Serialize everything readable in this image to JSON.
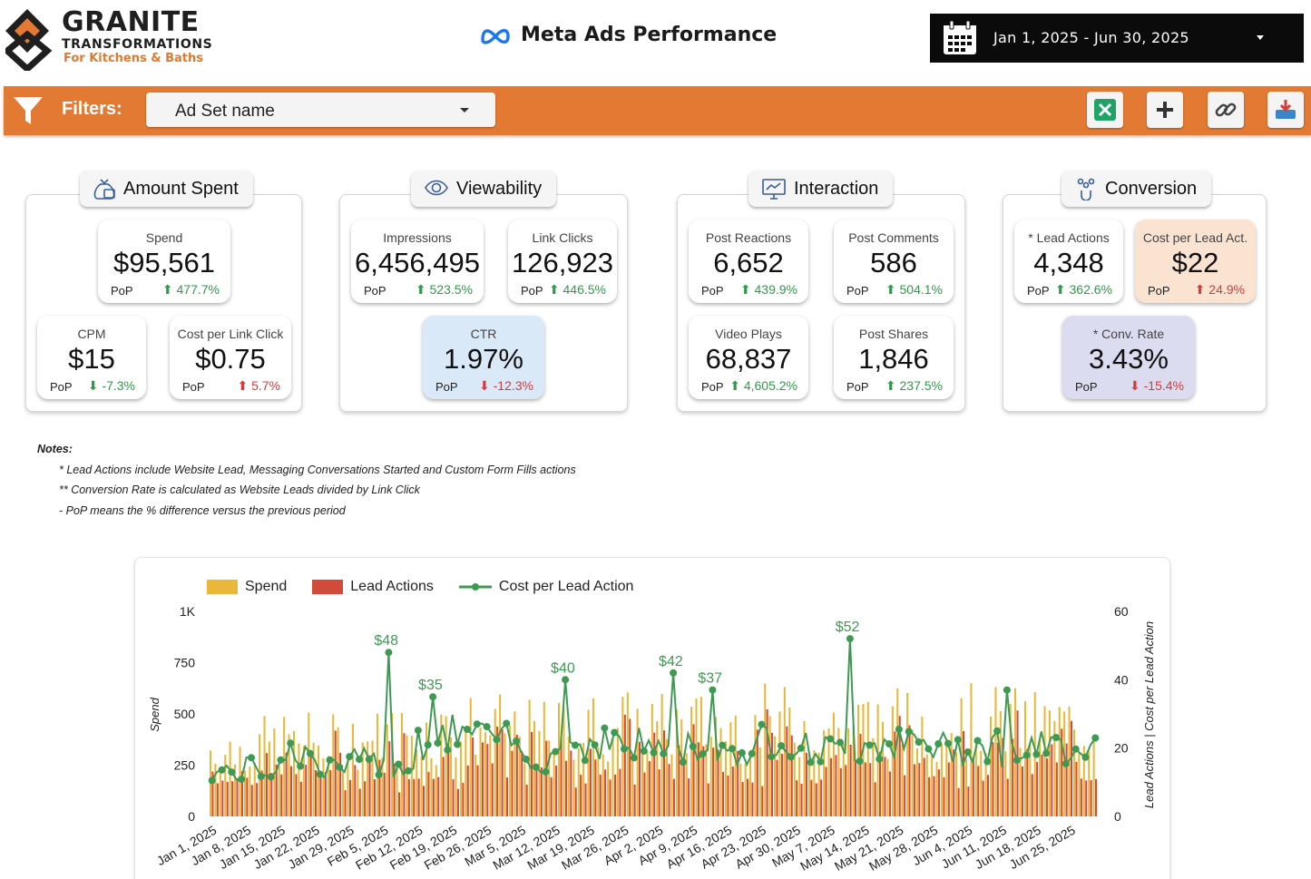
{
  "brand": {
    "name": "GRANITE",
    "line2": "TRANSFORMATIONS",
    "tagline": "For Kitchens & Baths",
    "accent": "#e37a33"
  },
  "header": {
    "title": "Meta Ads Performance",
    "date_range": "Jan 1, 2025 - Jun 30, 2025"
  },
  "filters": {
    "label": "Filters:",
    "selector": "Ad Set name"
  },
  "sections": {
    "amount_spent": "Amount Spent",
    "viewability": "Viewability",
    "interaction": "Interaction",
    "conversion": "Conversion"
  },
  "pop_label": "PoP",
  "metrics": {
    "spend": {
      "label": "Spend",
      "value": "$95,561",
      "change": "477.7%"
    },
    "cpm": {
      "label": "CPM",
      "value": "$15",
      "change": "-7.3%"
    },
    "cplc": {
      "label": "Cost per Link Click",
      "value": "$0.75",
      "change": "5.7%"
    },
    "impressions": {
      "label": "Impressions",
      "value": "6,456,495",
      "change": "523.5%"
    },
    "link_clicks": {
      "label": "Link Clicks",
      "value": "126,923",
      "change": "446.5%"
    },
    "ctr": {
      "label": "CTR",
      "value": "1.97%",
      "change": "-12.3%"
    },
    "post_reactions": {
      "label": "Post Reactions",
      "value": "6,652",
      "change": "439.9%"
    },
    "post_comments": {
      "label": "Post Comments",
      "value": "586",
      "change": "504.1%"
    },
    "video_plays": {
      "label": "Video Plays",
      "value": "68,837",
      "change": "4,605.2%"
    },
    "post_shares": {
      "label": "Post Shares",
      "value": "1,846",
      "change": "237.5%"
    },
    "lead_actions": {
      "label": "* Lead Actions",
      "value": "4,348",
      "change": "362.6%"
    },
    "cost_per_lead": {
      "label": "Cost per Lead Act.",
      "value": "$22",
      "change": "24.9%"
    },
    "conv_rate": {
      "label": "* Conv. Rate",
      "value": "3.43%",
      "change": "-15.4%"
    }
  },
  "notes": {
    "heading": "Notes:",
    "line1": "* Lead Actions include Website Lead, Messaging Conversations Started and Custom Form Fills actions",
    "line2": "** Conversion Rate is calculated as Website Leads divided by Link Click",
    "line3": "- PoP means the % difference versus the previous period"
  },
  "colors": {
    "spend": "#e9b83b",
    "lead_actions": "#d24b3a",
    "cost_per_lead": "#3e9a52",
    "card_orange": "#fbe3d2",
    "card_blue": "#d9e9f7",
    "card_purple": "#dcdcf0"
  },
  "chart_data": {
    "type": "bar",
    "legend": [
      "Spend",
      "Lead Actions",
      "Cost per Lead Action"
    ],
    "ylabel": "Spend",
    "ylabel_right": "Lead Actions | Cost per Lead Action",
    "ylim": [
      0,
      1000
    ],
    "ylim_right": [
      0,
      60
    ],
    "y_ticks": [
      "0",
      "250",
      "500",
      "750",
      "1K"
    ],
    "y_ticks_right": [
      "0",
      "20",
      "40",
      "60"
    ],
    "x_ticks": [
      "Jan 1, 2025",
      "Jan 8, 2025",
      "Jan 15, 2025",
      "Jan 22, 2025",
      "Jan 29, 2025",
      "Feb 5, 2025",
      "Feb 12, 2025",
      "Feb 19, 2025",
      "Feb 26, 2025",
      "Mar 5, 2025",
      "Mar 12, 2025",
      "Mar 19, 2025",
      "Mar 26, 2025",
      "Apr 2, 2025",
      "Apr 9, 2025",
      "Apr 16, 2025",
      "Apr 23, 2025",
      "Apr 30, 2025",
      "May 7, 2025",
      "May 14, 2025",
      "May 21, 2025",
      "May 28, 2025",
      "Jun 4, 2025",
      "Jun 11, 2025",
      "Jun 18, 2025",
      "Jun 25, 2025"
    ],
    "cost_per_lead_weekly": [
      13,
      14,
      19,
      14,
      16,
      15,
      22,
      25,
      22,
      17,
      21,
      22,
      21,
      20,
      21,
      19,
      23,
      20,
      19,
      22,
      21,
      20,
      21,
      19,
      20,
      21
    ],
    "annotated_peaks": [
      {
        "label": "$48",
        "value": 48
      },
      {
        "label": "$40",
        "value": 40
      },
      {
        "label": "$35",
        "value": 35
      },
      {
        "label": "$42",
        "value": 42
      },
      {
        "label": "$37",
        "value": 37
      },
      {
        "label": "$52",
        "value": 52
      }
    ]
  }
}
